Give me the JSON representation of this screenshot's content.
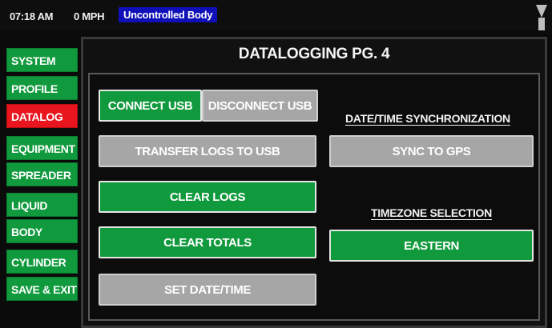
{
  "status": {
    "time": "07:18 AM",
    "speed": "0 MPH",
    "alert": "Uncontrolled Body"
  },
  "sidebar": {
    "items": [
      {
        "label": "SYSTEM",
        "active": false
      },
      {
        "label": "PROFILE",
        "active": false
      },
      {
        "label": "DATALOG",
        "active": true
      },
      {
        "label": "EQUIPMENT",
        "active": false
      },
      {
        "label": "SPREADER",
        "active": false
      },
      {
        "label": "LIQUID",
        "active": false
      },
      {
        "label": "BODY",
        "active": false
      },
      {
        "label": "CYLINDER",
        "active": false
      },
      {
        "label": "SAVE & EXIT",
        "active": false
      }
    ]
  },
  "main": {
    "title": "DATALOGGING PG. 4",
    "connect_usb": "CONNECT USB",
    "disconnect_usb": "DISCONNECT USB",
    "transfer_logs": "TRANSFER LOGS TO USB",
    "clear_logs": "CLEAR LOGS",
    "clear_totals": "CLEAR TOTALS",
    "set_date_time": "SET DATE/TIME",
    "sync_heading": "DATE/TIME SYNCHRONIZATION",
    "sync_gps": "SYNC TO GPS",
    "timezone_heading": "TIMEZONE SELECTION",
    "timezone_value": "EASTERN"
  },
  "colors": {
    "accent_green": "#119a3d",
    "active_red": "#e8141e",
    "disabled_gray": "#a6a6a6",
    "alert_blue": "#1010b8"
  }
}
